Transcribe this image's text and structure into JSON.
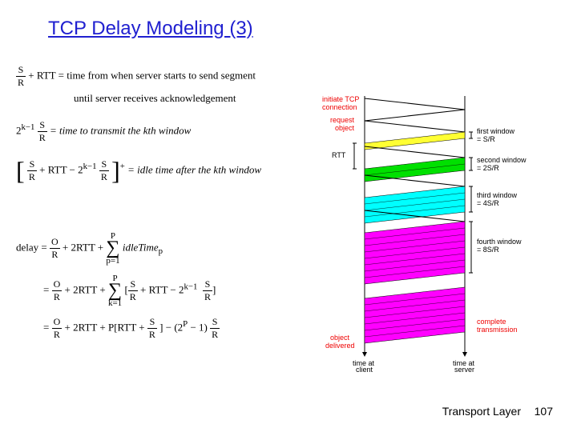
{
  "title": "TCP Delay Modeling (3)",
  "eq": {
    "l1a": " + RTT = time from when server starts to send segment",
    "l1b": "until server receives acknowledgement",
    "l2_pre": "2",
    "l2_sup": "k−1",
    "l2_post": " = time to transmit the kth window",
    "l3a_pre": " + RTT − 2",
    "l3a_sup": "k−1",
    "l3a_sup2": "+",
    "l3a_post": " = idle time after the kth window",
    "delay1_left": "delay = ",
    "delay1_mid": " + 2RTT + ",
    "delay1_idle": " idleTime",
    "delay1_sub": "p",
    "sum_top1": "P",
    "sum_bot1": "p=1",
    "delay2_left": " = ",
    "delay2_mid": " + 2RTT + ",
    "sum_top2": "P",
    "sum_bot2": "k=1",
    "delay2_in1": " + RTT − 2",
    "delay2_sup": "k−1",
    "delay3_left": " = ",
    "delay3_mid": " + 2RTT + P[RTT + ",
    "delay3_mid2": "] − (2",
    "delay3_sup": "P",
    "delay3_mid3": " − 1) ",
    "SR_num": "S",
    "SR_den": "R",
    "OR_num": "O",
    "OR_den": "R"
  },
  "diagram": {
    "initiate": "initiate TCP",
    "connection": "connection",
    "request": "request",
    "object": "object",
    "rtt": "RTT",
    "w1a": "first window",
    "w1b": "= S/R",
    "w2a": "second window",
    "w2b": "= 2S/R",
    "w3a": "third window",
    "w3b": "= 4S/R",
    "w4a": "fourth window",
    "w4b": "= 8S/R",
    "delivered1": "object",
    "delivered2": "delivered",
    "complete1": "complete",
    "complete2": "transmission",
    "client1": "time at",
    "client2": "client",
    "server1": "time at",
    "server2": "server"
  },
  "footer": {
    "label": "Transport Layer",
    "page": "107"
  }
}
